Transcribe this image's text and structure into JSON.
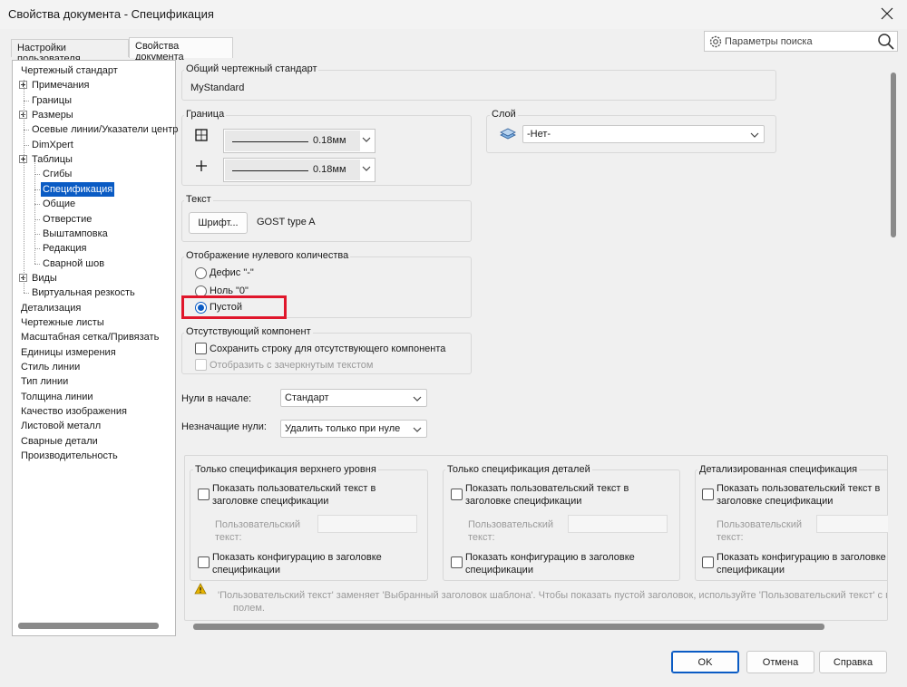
{
  "window": {
    "title": "Свойства документа - Спецификация"
  },
  "tabs": [
    {
      "label": "Настройки пользователя"
    },
    {
      "label": "Свойства документа"
    }
  ],
  "search": {
    "placeholder": "Параметры поиска"
  },
  "tree": {
    "items": [
      {
        "label": "Чертежный стандарт",
        "expandable": false,
        "selected": false
      },
      {
        "label": "Примечания",
        "expandable": true,
        "selected": false
      },
      {
        "label": "Границы",
        "expandable": false,
        "selected": false
      },
      {
        "label": "Размеры",
        "expandable": true,
        "selected": false
      },
      {
        "label": "Осевые линии/Указатели центра",
        "expandable": false,
        "selected": false
      },
      {
        "label": "DimXpert",
        "expandable": false,
        "selected": false
      },
      {
        "label": "Таблицы",
        "expandable": true,
        "selected": false
      },
      {
        "label": "Сгибы",
        "expandable": false,
        "selected": false
      },
      {
        "label": "Спецификация",
        "expandable": false,
        "selected": true
      },
      {
        "label": "Общие",
        "expandable": false,
        "selected": false
      },
      {
        "label": "Отверстие",
        "expandable": false,
        "selected": false
      },
      {
        "label": "Выштамповка",
        "expandable": false,
        "selected": false
      },
      {
        "label": "Редакция",
        "expandable": false,
        "selected": false
      },
      {
        "label": "Сварной шов",
        "expandable": false,
        "selected": false
      },
      {
        "label": "Виды",
        "expandable": true,
        "selected": false
      },
      {
        "label": "Виртуальная резкость",
        "expandable": false,
        "selected": false
      },
      {
        "label": "Детализация",
        "expandable": false,
        "selected": false
      },
      {
        "label": "Чертежные листы",
        "expandable": false,
        "selected": false
      },
      {
        "label": "Масштабная сетка/Привязать",
        "expandable": false,
        "selected": false
      },
      {
        "label": "Единицы измерения",
        "expandable": false,
        "selected": false
      },
      {
        "label": "Стиль линии",
        "expandable": false,
        "selected": false
      },
      {
        "label": "Тип линии",
        "expandable": false,
        "selected": false
      },
      {
        "label": "Толщина линии",
        "expandable": false,
        "selected": false
      },
      {
        "label": "Качество изображения",
        "expandable": false,
        "selected": false
      },
      {
        "label": "Листовой металл",
        "expandable": false,
        "selected": false
      },
      {
        "label": "Сварные детали",
        "expandable": false,
        "selected": false
      },
      {
        "label": "Производительность",
        "expandable": false,
        "selected": false
      }
    ]
  },
  "standard": {
    "label": "Общий чертежный стандарт",
    "value": "MyStandard"
  },
  "border": {
    "label": "Граница",
    "outer_thickness": "0.18мм",
    "inner_thickness": "0.18мм"
  },
  "layer": {
    "label": "Слой",
    "value": "-Нет-"
  },
  "text": {
    "label": "Текст",
    "font_button": "Шрифт...",
    "font_value": "GOST type A"
  },
  "zero_qty": {
    "label": "Отображение нулевого количества",
    "options": [
      "Дефис \"-\"",
      "Ноль \"0\"",
      "Пустой"
    ],
    "selected": "Пустой"
  },
  "missing": {
    "label": "Отсутствующий компонент",
    "keep_row": "Сохранить строку для отсутствующего компонента",
    "strikethrough": "Отобразить с зачеркнутым текстом"
  },
  "leading_zeros": {
    "label": "Нули в начале:",
    "value": "Стандарт"
  },
  "trailing_zeros": {
    "label": "Незначащие нули:",
    "value": "Удалить только при нуле"
  },
  "bom_groups": [
    {
      "label": "Только спецификация верхнего уровня",
      "show_text": "Показать пользовательский текст в заголовке спецификации",
      "custom_label": "Пользовательский текст:",
      "show_config": "Показать конфигурацию в заголовке спецификации"
    },
    {
      "label": "Только спецификация деталей",
      "show_text": "Показать пользовательский текст в заголовке спецификации",
      "custom_label": "Пользовательский текст:",
      "show_config": "Показать конфигурацию в заголовке спецификации"
    },
    {
      "label": "Детализированная спецификация",
      "show_text": "Показать пользовательский текст в заголовке спецификации",
      "custom_label": "Пользовательский текст:",
      "show_config": "Показать конфигурацию в заголовке спецификации"
    }
  ],
  "warning": {
    "line1": "'Пользовательский текст' заменяет 'Выбранный заголовок шаблона'. Чтобы показать пустой заголовок, используйте 'Пользовательский текст' с пусты",
    "line2": "полем."
  },
  "buttons": {
    "ok": "OK",
    "cancel": "Отмена",
    "help": "Справка"
  },
  "colors": {
    "selection": "#0a5bc4",
    "highlight_box": "#e0162b",
    "warning": "#e8b400"
  }
}
